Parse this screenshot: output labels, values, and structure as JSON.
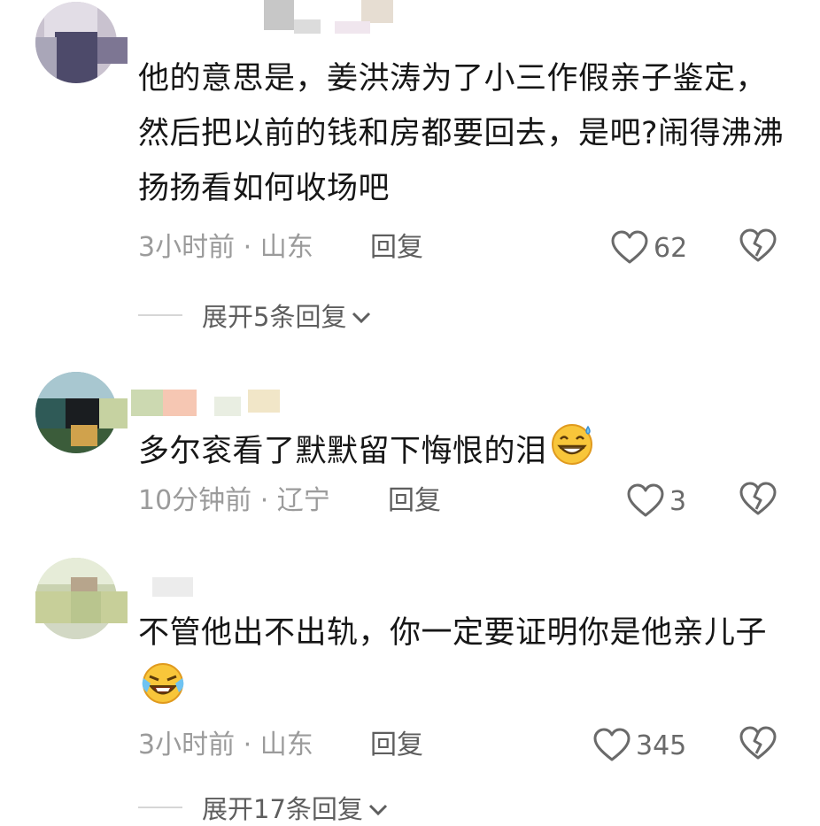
{
  "comments": [
    {
      "text": "他的意思是，姜洪涛为了小三作假亲子鉴定，然后把以前的钱和房都要回去，是吧?闹得沸沸扬扬看如何收场吧",
      "time_location": "3小时前 · 山东",
      "reply_label": "回复",
      "likes": "62",
      "expand_label": "展开5条回复"
    },
    {
      "text": "多尔衮看了默默留下悔恨的泪",
      "emoji": "sweat-grin-emoji",
      "time_location": "10分钟前 · 辽宁",
      "reply_label": "回复",
      "likes": "3"
    },
    {
      "text": "不管他出不出轨，你一定要证明你是他亲儿子",
      "emoji": "rolling-laugh-emoji",
      "time_location": "3小时前 · 山东",
      "reply_label": "回复",
      "likes": "345",
      "expand_label": "展开17条回复"
    }
  ],
  "colors": {
    "text": "#161616",
    "meta": "#9b9b9b",
    "reply": "#5e5e5e",
    "icon": "#6a6a6a"
  }
}
